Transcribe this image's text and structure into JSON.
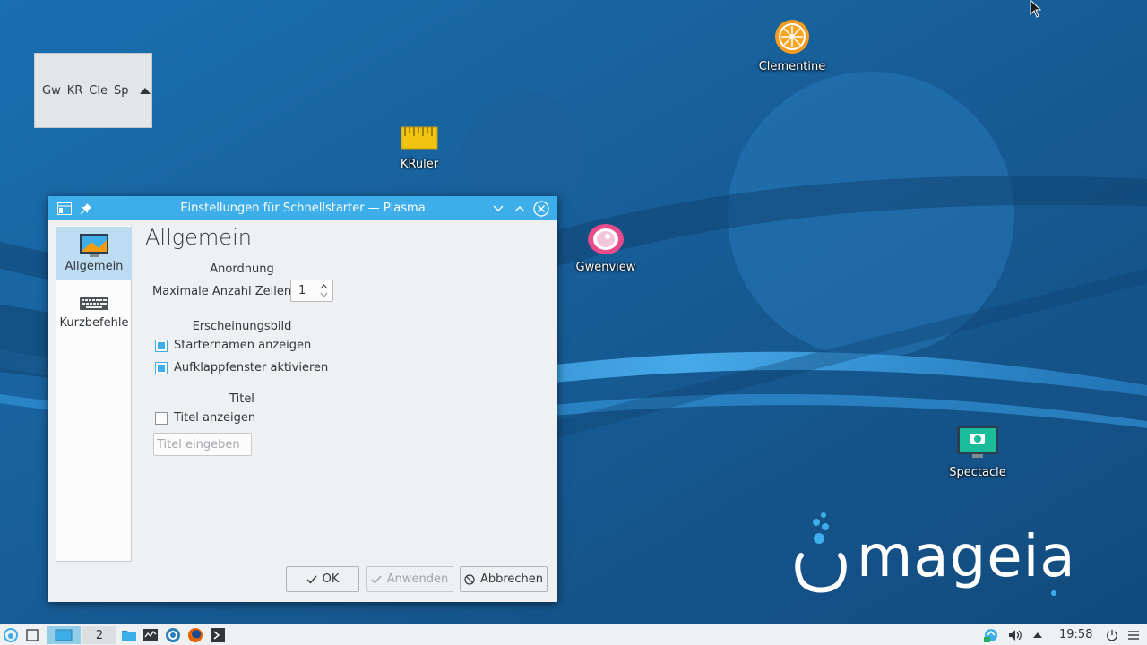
{
  "desktop": {
    "icons": [
      {
        "label": "Clementine",
        "icon": "clementine-icon"
      },
      {
        "label": "KRuler",
        "icon": "kruler-icon"
      },
      {
        "label": "Gwenview",
        "icon": "gwenview-icon"
      },
      {
        "label": "Spectacle",
        "icon": "spectacle-icon"
      }
    ],
    "logo_text": "mageia"
  },
  "quicklaunch": {
    "items": [
      "Gw",
      "KR",
      "Cle",
      "Sp"
    ],
    "expand_icon": "triangle-up-icon"
  },
  "dialog": {
    "title": "Einstellungen für Schnellstarter — Plasma",
    "sidebar": [
      {
        "label": "Allgemein",
        "icon": "general-settings-icon",
        "active": true
      },
      {
        "label": "Kurzbefehle",
        "icon": "keyboard-icon",
        "active": false
      }
    ],
    "page_title": "Allgemein",
    "sections": {
      "arrangement": {
        "heading": "Anordnung",
        "max_rows_label": "Maximale Anzahl Zeilen:",
        "max_rows_value": "1"
      },
      "appearance": {
        "heading": "Erscheinungsbild",
        "show_names_label": "Starternamen anzeigen",
        "show_names_checked": true,
        "popup_label": "Aufklappfenster aktivieren",
        "popup_checked": true
      },
      "title": {
        "heading": "Titel",
        "show_title_label": "Titel anzeigen",
        "show_title_checked": false,
        "title_placeholder": "Titel eingeben"
      }
    },
    "buttons": {
      "ok": "OK",
      "apply": "Anwenden",
      "cancel": "Abbrechen"
    }
  },
  "taskbar": {
    "desktop_number": "2",
    "clock": "19:58"
  },
  "colors": {
    "accent": "#3daee9",
    "desktop_bg": "#1d6aa6",
    "panel_bg": "#eff0f1"
  }
}
